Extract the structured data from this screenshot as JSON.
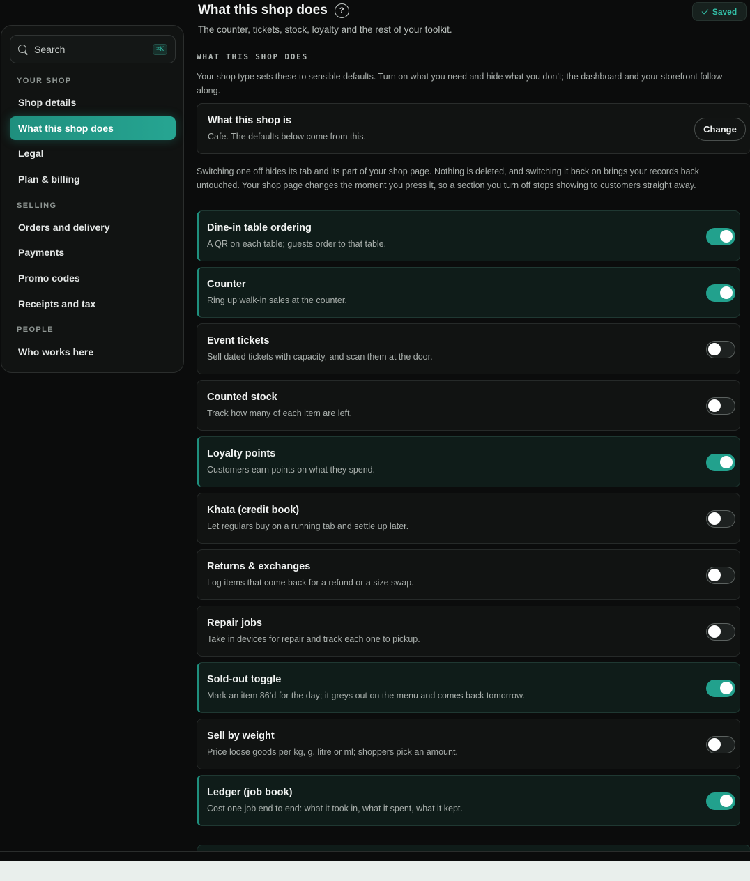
{
  "header": {
    "title": "What this shop does",
    "help_icon": "?",
    "saved_label": "Saved",
    "subtitle": "The counter, tickets, stock, loyalty and the rest of your toolkit."
  },
  "sidebar": {
    "search": {
      "label": "Search",
      "shortcut": "⌘K"
    },
    "sections": [
      {
        "label": "YOUR SHOP"
      },
      {
        "label": "SELLING"
      },
      {
        "label": "PEOPLE"
      }
    ],
    "items": [
      {
        "label": "Shop details"
      },
      {
        "label": "What this shop does",
        "active": true
      },
      {
        "label": "Legal"
      },
      {
        "label": "Plan & billing"
      },
      {
        "label": "Orders and delivery"
      },
      {
        "label": "Payments"
      },
      {
        "label": "Promo codes"
      },
      {
        "label": "Receipts and tax"
      },
      {
        "label": "Who works here"
      }
    ]
  },
  "main": {
    "section_label": "WHAT THIS SHOP DOES",
    "intro": "Your shop type sets these to sensible defaults. Turn on what you need and hide what you don’t; the dashboard and your storefront follow along.",
    "shop_type": {
      "title": "What this shop is",
      "description": "Cafe. The defaults below come from this.",
      "change_label": "Change"
    },
    "note": "Switching one off hides its tab and its part of your shop page. Nothing is deleted, and switching it back on brings your records back untouched. Your shop page changes the moment you press it, so a section you turn off stops showing to customers straight away.",
    "features": [
      {
        "title": "Dine-in table ordering",
        "description": "A QR on each table; guests order to that table.",
        "enabled": true
      },
      {
        "title": "Counter",
        "description": "Ring up walk-in sales at the counter.",
        "enabled": true
      },
      {
        "title": "Event tickets",
        "description": "Sell dated tickets with capacity, and scan them at the door.",
        "enabled": false
      },
      {
        "title": "Counted stock",
        "description": "Track how many of each item are left.",
        "enabled": false
      },
      {
        "title": "Loyalty points",
        "description": "Customers earn points on what they spend.",
        "enabled": true
      },
      {
        "title": "Khata (credit book)",
        "description": "Let regulars buy on a running tab and settle up later.",
        "enabled": false
      },
      {
        "title": "Returns & exchanges",
        "description": "Log items that come back for a refund or a size swap.",
        "enabled": false
      },
      {
        "title": "Repair jobs",
        "description": "Take in devices for repair and track each one to pickup.",
        "enabled": false
      },
      {
        "title": "Sold-out toggle",
        "description": "Mark an item 86’d for the day; it greys out on the menu and comes back tomorrow.",
        "enabled": true
      },
      {
        "title": "Sell by weight",
        "description": "Price loose goods per kg, g, litre or ml; shoppers pick an amount.",
        "enabled": false
      },
      {
        "title": "Ledger (job book)",
        "description": "Cost one job end to end: what it took in, what it spent, what it kept.",
        "enabled": true
      }
    ]
  },
  "colors": {
    "accent": "#22a18d",
    "background": "#0b0c0c",
    "card": "#111312",
    "enabled_card": "#0f1c19"
  }
}
